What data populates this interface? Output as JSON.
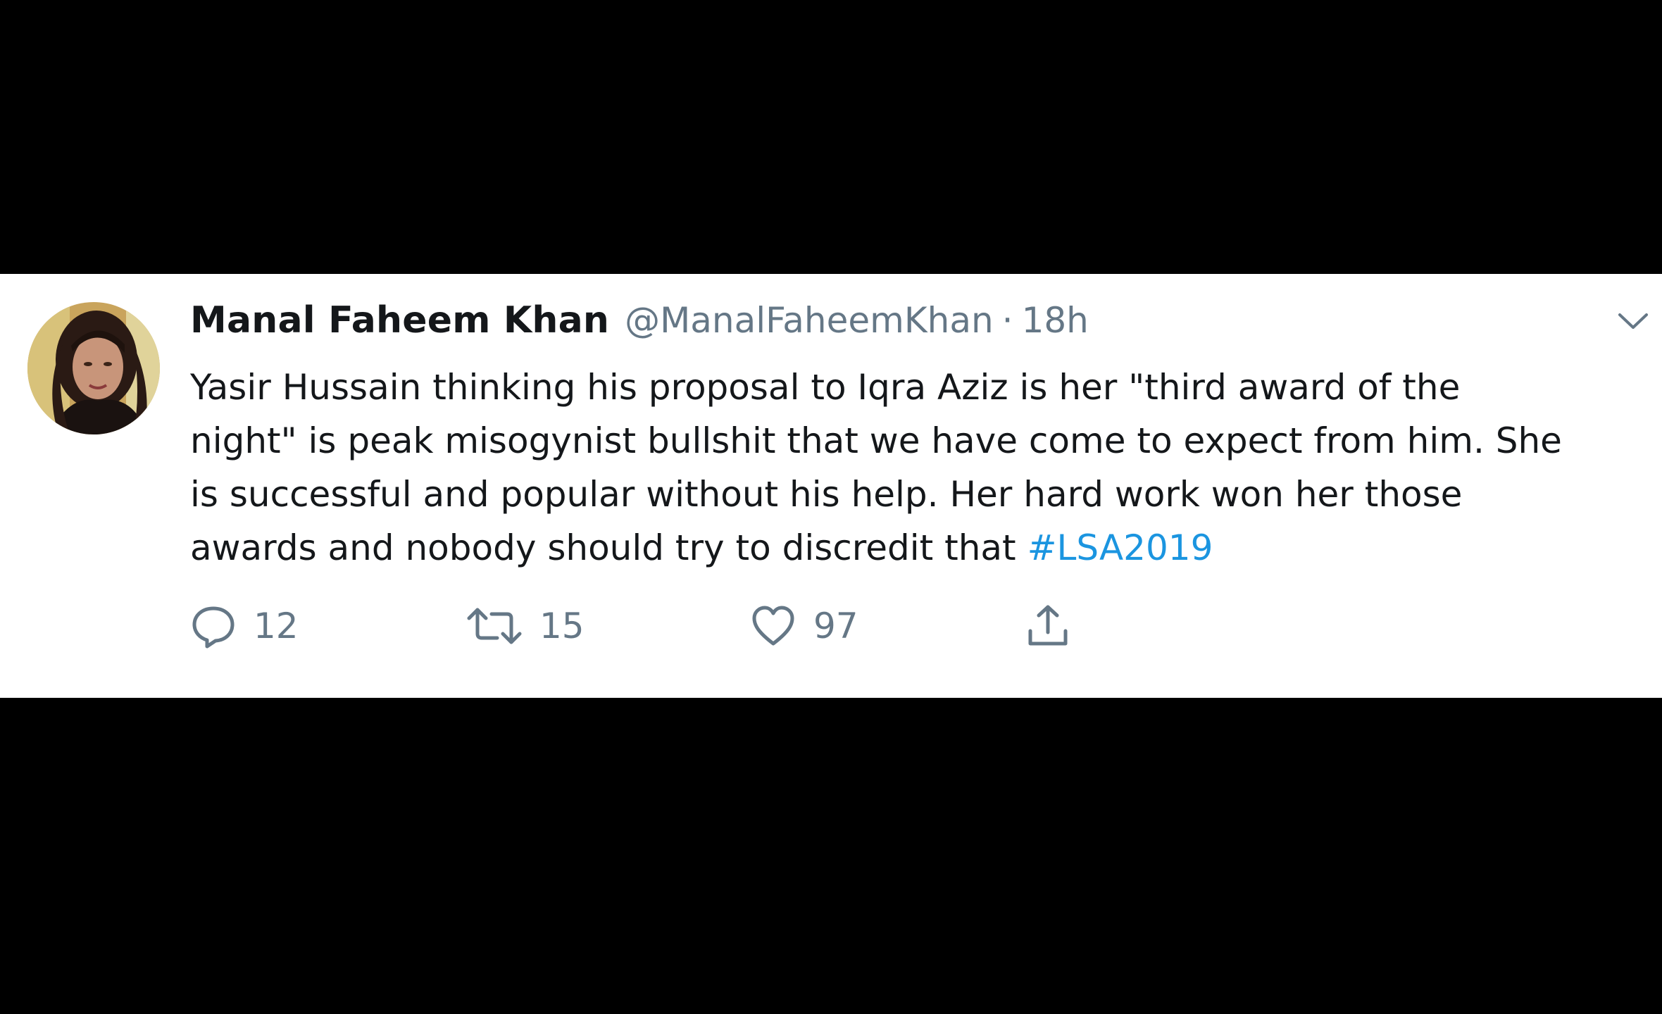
{
  "tweet": {
    "display_name": "Manal Faheem Khan",
    "handle": "@ManalFaheemKhan",
    "separator": "·",
    "timestamp": "18h",
    "text_lines": [
      "Yasir Hussain thinking his proposal to Iqra Aziz is her \"third award of the",
      "night\" is peak misogynist bullshit that we have come to expect from him. She",
      "is successful and popular without his help. Her hard work won her those",
      "awards and nobody should try to discredit that "
    ],
    "hashtag": "#LSA2019",
    "counts": {
      "replies": "12",
      "retweets": "15",
      "likes": "97"
    }
  },
  "icons": {
    "avatar": "profile-photo",
    "caret": "chevron-down-icon",
    "reply": "reply-icon",
    "retweet": "retweet-icon",
    "like": "heart-icon",
    "share": "share-icon"
  },
  "colors": {
    "background_bands": "#000000",
    "card": "#ffffff",
    "primary_text": "#14171a",
    "secondary_text": "#657786",
    "link": "#1b95e0"
  }
}
